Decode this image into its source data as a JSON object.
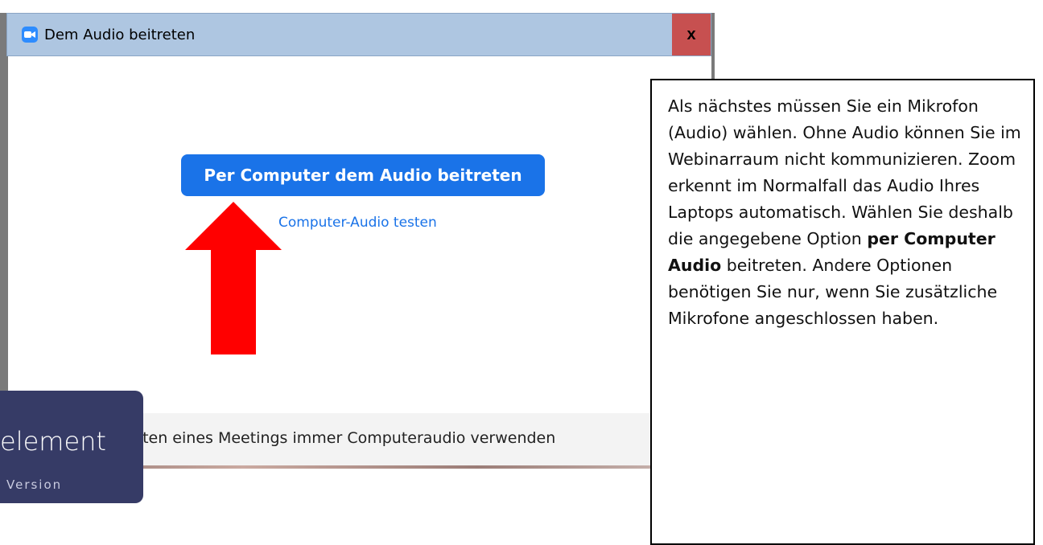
{
  "window": {
    "title": "Dem Audio beitreten",
    "close_label": "x"
  },
  "main": {
    "join_button_label": "Per Computer dem Audio beitreten",
    "test_link_label": "Computer-Audio testen"
  },
  "footer": {
    "checkbox_label": "Beim Beitreten eines Meetings immer Computeraudio verwenden"
  },
  "watermark": {
    "brand": "element",
    "subtitle": "Version"
  },
  "callout": {
    "text_before": "Als nächstes müssen Sie ein Mikrofon (Audio) wählen. Ohne Audio können Sie im Webinarraum nicht kommunizieren. Zoom erkennt im Normalfall das Audio Ihres Laptops automatisch. Wählen Sie deshalb die angegebene Option ",
    "text_bold": "per Computer Audio",
    "text_after": " beitreten. Andere Optionen benötigen Sie nur, wenn Sie zusätzliche Mikrofone angeschlossen haben."
  },
  "colors": {
    "accent": "#1a73e8",
    "arrow": "#ff0000",
    "close": "#c75050",
    "titlebar": "#aec6e1"
  },
  "icons": {
    "app_icon": "zoom-camera-icon",
    "pointer": "red-arrow-up-icon"
  }
}
